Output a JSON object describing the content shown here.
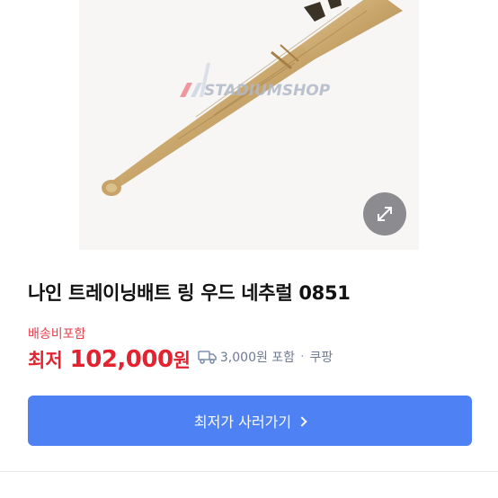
{
  "product": {
    "title": "나인 트레이닝배트 링 우드 네추럴 0851",
    "watermark": "STADIUMSHOP"
  },
  "price": {
    "shipping_note": "배송비포함",
    "prefix": "최저",
    "value": "102,000",
    "unit": "원",
    "shipping_fee": "3,000원 포함",
    "separator": "·",
    "seller": "쿠팡"
  },
  "actions": {
    "buy_label": "최저가 사러가기"
  },
  "icons": {
    "expand": "expand-arrows-icon",
    "truck": "delivery-truck-icon",
    "chevron": "chevron-right-icon"
  },
  "colors": {
    "price_red": "#e5222f",
    "note_red": "#e5404b",
    "button_blue": "#4e82f4",
    "muted": "#6f7a90"
  }
}
